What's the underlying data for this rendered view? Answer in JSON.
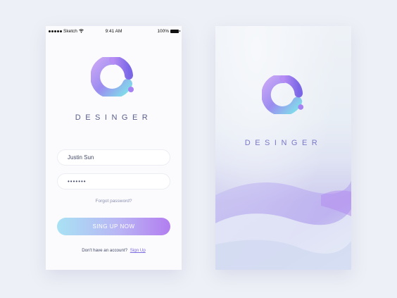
{
  "status_bar": {
    "carrier": "Sketch",
    "time": "9:41 AM",
    "battery": "100%"
  },
  "login": {
    "brand": "DESINGER",
    "username_value": "Justin Sun",
    "password_value": "•••••••",
    "forgot_label": "Forgot password?",
    "signup_button_label": "SING UP NOW",
    "account_prompt": "Don't have an account?",
    "signup_link_label": "Sign Up"
  },
  "splash": {
    "brand": "DESINGER"
  },
  "colors": {
    "accent_purple": "#b27ef0",
    "accent_cyan": "#a8e2f4",
    "brand_text": "#5a5f8a"
  }
}
